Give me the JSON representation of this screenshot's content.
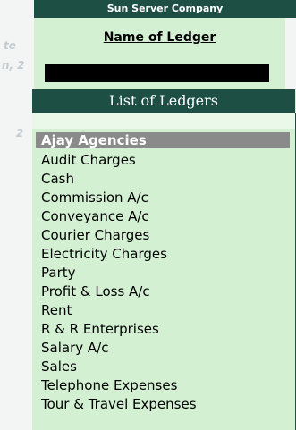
{
  "window": {
    "company_name": "Sun Server Company"
  },
  "background_fragments": [
    "te",
    "n, 2",
    "2"
  ],
  "ledger_panel": {
    "title": "Name of Ledger",
    "name_value": ""
  },
  "ledger_list": {
    "header": "List of Ledgers",
    "selected_index": 0,
    "items": [
      "Ajay Agencies",
      "Audit Charges",
      "Cash",
      "Commission A/c",
      "Conveyance A/c",
      "Courier Charges",
      "Electricity Charges",
      "Party",
      "Profit & Loss A/c",
      "Rent",
      "R & R Enterprises",
      "Salary A/c",
      "Sales",
      "Telephone Expenses",
      "Tour & Travel Expenses"
    ]
  }
}
